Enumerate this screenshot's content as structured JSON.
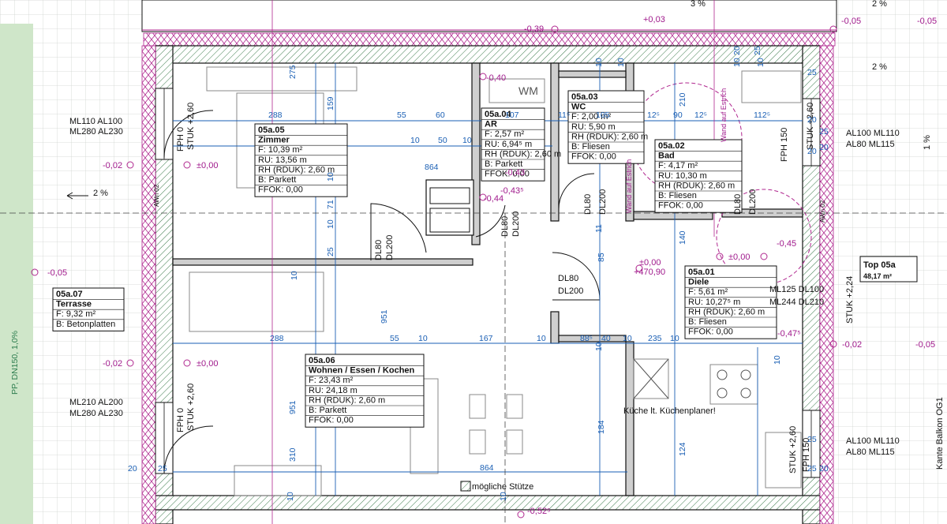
{
  "rooms": [
    {
      "id": "05a.05",
      "name": "Zimmer",
      "lines": [
        "F: 10,39 m²",
        "RU: 13,56 m",
        "RH (RDUK): 2,60 m",
        "B: Parkett",
        "FFOK: 0,00"
      ]
    },
    {
      "id": "05a.04",
      "name": "AR",
      "lines": [
        "F: 2,57 m²",
        "RU: 6,94⁵ m",
        "RH (RDUK): 2,60 m",
        "B: Parkett",
        "FFOK: 0,00"
      ]
    },
    {
      "id": "05a.03",
      "name": "WC",
      "lines": [
        "F: 2,00 m²",
        "RU: 5,90 m",
        "RH (RDUK): 2,60 m",
        "B: Fliesen",
        "FFOK: 0,00"
      ]
    },
    {
      "id": "05a.02",
      "name": "Bad",
      "lines": [
        "F: 4,17 m²",
        "RU: 10,30 m",
        "RH (RDUK): 2,60 m",
        "B: Fliesen",
        "FFOK: 0,00"
      ]
    },
    {
      "id": "05a.01",
      "name": "Diele",
      "lines": [
        "F: 5,61 m²",
        "RU: 10,27⁵ m",
        "RH (RDUK): 2,60 m",
        "B: Fliesen",
        "FFOK: 0,00"
      ]
    },
    {
      "id": "05a.06",
      "name": "Wohnen / Essen / Kochen",
      "lines": [
        "F: 23,43 m²",
        "RU: 24,18 m",
        "RH (RDUK): 2,60 m",
        "B: Parkett",
        "FFOK: 0,00"
      ]
    },
    {
      "id": "05a.07",
      "name": "Terrasse",
      "lines": [
        "F: 9,32 m²",
        "B: Betonplatten"
      ]
    }
  ],
  "top": {
    "title": "Top 05a",
    "area": "48,17 m²"
  },
  "labels": {
    "wm": "WM",
    "kitchen_note": "Küche lt. Küchenplaner!",
    "column_note": "mögliche Stütze",
    "balcony_edge": "Kante Balkon OG1",
    "pipe": "PP, DN150, 1,0%",
    "estrich_1": "Wand auf Estrich",
    "estrich_2": "Wand auf Estrich",
    "slope_1": "3 %",
    "slope_2": "2 %",
    "slope_3": "2 %",
    "slope_4": "2 %",
    "slope_5": "1 %",
    "awn_1": "AWn 02",
    "awn_2": "AWn 02"
  },
  "openings": [
    "ML110 AL100",
    "ML280 AL230",
    "ML210 AL200",
    "ML280 AL230",
    "AL100 ML110",
    "AL80 ML115",
    "AL100 ML110",
    "AL80 ML115",
    "ML125 DL100",
    "ML244 DL210",
    "DL80",
    "DL200",
    "DL80",
    "DL200",
    "DL80",
    "DL200",
    "DL80",
    "DL200",
    "DL80",
    "DL200",
    "FPH 0",
    "STUK +2,60",
    "FPH 0",
    "STUK +2,60",
    "FPH 150",
    "STUK +2,60",
    "FPH 150",
    "STUK +2,60",
    "STUK +2,24"
  ],
  "levels": [
    "-0,39",
    "-0,05",
    "-0,05",
    "-0,40",
    "-0,43",
    "-0,43⁵",
    "-0,44",
    "-0,02",
    "±0,00",
    "-0,05",
    "-0,02",
    "±0,00",
    "±0,00",
    "+470,90",
    "±0,00",
    "-0,45",
    "-0,47⁵",
    "-0,02",
    "-0,05",
    "-0,52⁵",
    "+0,03"
  ],
  "dimensions": [
    "288",
    "55",
    "60",
    "107",
    "11⁵",
    "105",
    "12⁵",
    "90",
    "12⁵",
    "112⁵",
    "10",
    "50",
    "10",
    "864",
    "159",
    "275",
    "10",
    "71",
    "10",
    "25",
    "10",
    "951",
    "288",
    "55",
    "10",
    "167",
    "10",
    "88⁵",
    "40",
    "10",
    "235",
    "10",
    "951",
    "310",
    "864",
    "25",
    "20",
    "184",
    "124",
    "85",
    "140",
    "210",
    "10",
    "25",
    "20",
    "25",
    "20",
    "20",
    "25",
    "25",
    "20",
    "10",
    "10",
    "10",
    "10",
    "11",
    "10",
    "20",
    "25",
    "10",
    "10"
  ]
}
